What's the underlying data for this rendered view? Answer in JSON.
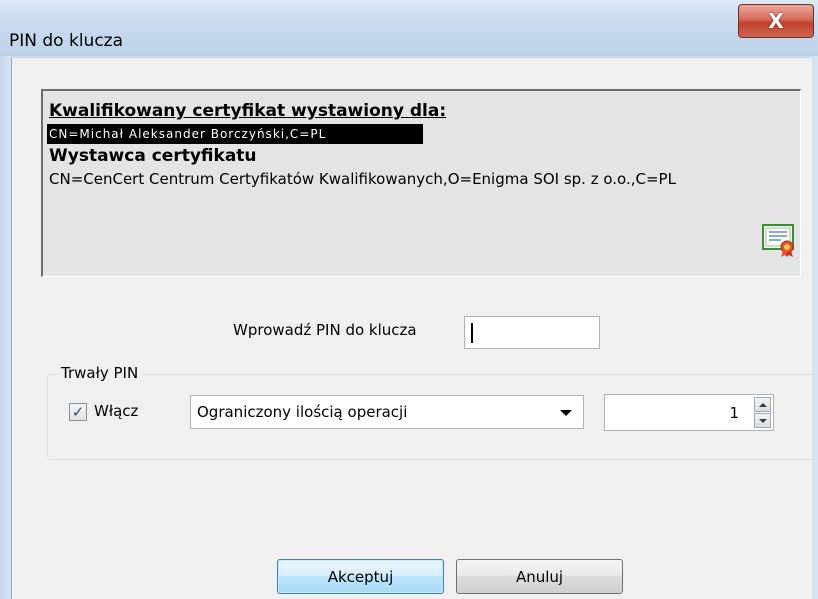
{
  "window": {
    "title": "PIN do klucza",
    "close_icon": "close-icon",
    "close_glyph": "X"
  },
  "certificate": {
    "heading": "Kwalifikowany certyfikat wystawiony dla:",
    "subject": "CN=Michał Aleksander Borczyński,C=PL",
    "issuer_heading": "Wystawca certyfikatu",
    "issuer_value": "CN=CenCert Centrum Certyfikatów Kwalifikowanych,O=Enigma SOI sp. z o.o.,C=PL",
    "icon": "certificate-icon"
  },
  "pin": {
    "label": "Wprowadź PIN do klucza",
    "value": ""
  },
  "persistent_pin": {
    "legend": "Trwały PIN",
    "enable_label": "Włącz",
    "enabled": true,
    "mode_selected": "Ograniczony ilością operacji",
    "count_value": "1"
  },
  "buttons": {
    "accept": "Akceptuj",
    "cancel": "Anuluj"
  },
  "colors": {
    "titlebar": "#c9dbef",
    "client_bg": "#f0f0f0",
    "default_button_border": "#3c7fb1",
    "close_button": "#c1412c"
  }
}
